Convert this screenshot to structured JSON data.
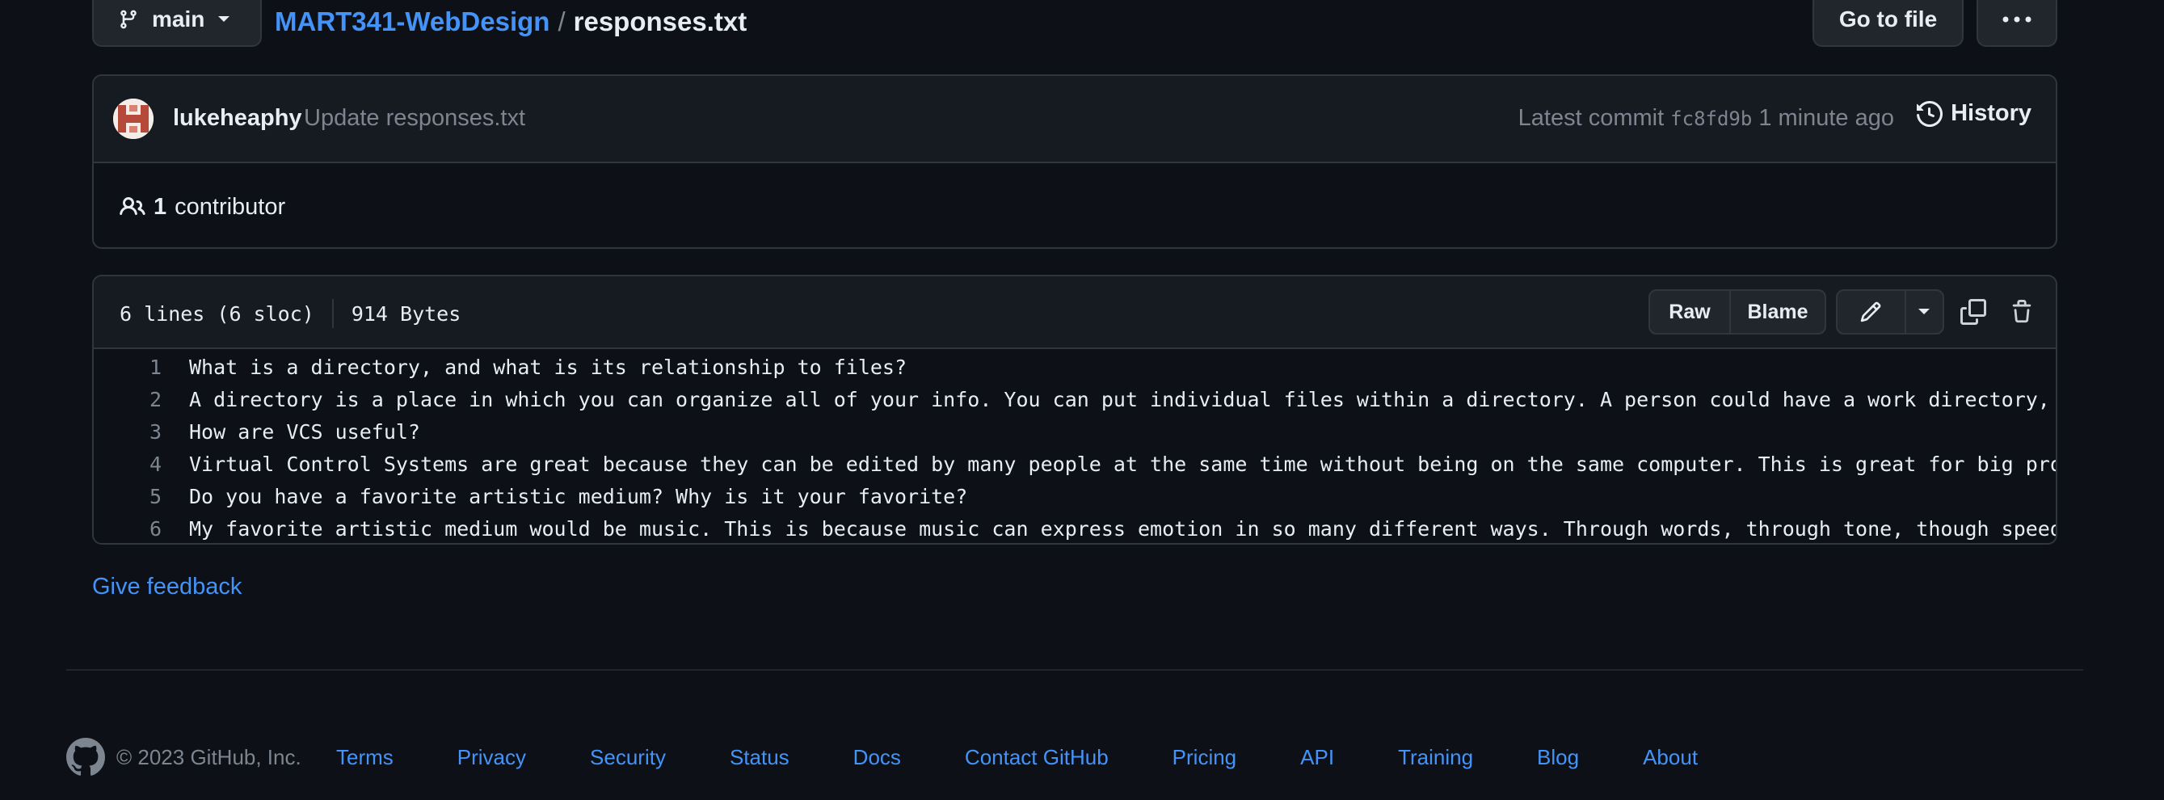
{
  "top": {
    "branch": "main",
    "repo": "MART341-WebDesign",
    "separator": "/",
    "file": "responses.txt",
    "goto_label": "Go to file"
  },
  "commit": {
    "author": "lukeheaphy",
    "message": "Update responses.txt",
    "latest_label": "Latest commit",
    "sha": "fc8fd9b",
    "time": "1 minute ago",
    "history_label": "History"
  },
  "contributors": {
    "count": "1",
    "label": "contributor"
  },
  "file": {
    "lines_info": "6 lines (6 sloc)",
    "size": "914 Bytes",
    "raw_label": "Raw",
    "blame_label": "Blame",
    "lines": [
      {
        "n": "1",
        "text": "What is a directory, and what is its relationship to files?"
      },
      {
        "n": "2",
        "text": "A directory is a place in which you can organize all of your info. You can put individual files within a directory. A person could have a work directory, a groc"
      },
      {
        "n": "3",
        "text": "How are VCS useful?"
      },
      {
        "n": "4",
        "text": "Virtual Control Systems are great because they can be edited by many people at the same time without being on the same computer. This is great for big projects"
      },
      {
        "n": "5",
        "text": "Do you have a favorite artistic medium? Why is it your favorite?"
      },
      {
        "n": "6",
        "text": "My favorite artistic medium would be music. This is because music can express emotion in so many different ways. Through words, through tone, though speed, or e"
      }
    ]
  },
  "feedback_label": "Give feedback",
  "footer": {
    "copyright": "© 2023 GitHub, Inc.",
    "links": [
      "Terms",
      "Privacy",
      "Security",
      "Status",
      "Docs",
      "Contact GitHub",
      "Pricing",
      "API",
      "Training",
      "Blog",
      "About"
    ]
  },
  "colors": {
    "background": "#0d1117",
    "accent_link": "#4493f8",
    "border": "#30363d",
    "muted_text": "#7d8590"
  },
  "icons": [
    "git-branch-icon",
    "caret-down-icon",
    "kebab-horizontal-icon",
    "history-icon",
    "people-icon",
    "pencil-icon",
    "copy-icon",
    "trash-icon",
    "github-mark-icon"
  ]
}
